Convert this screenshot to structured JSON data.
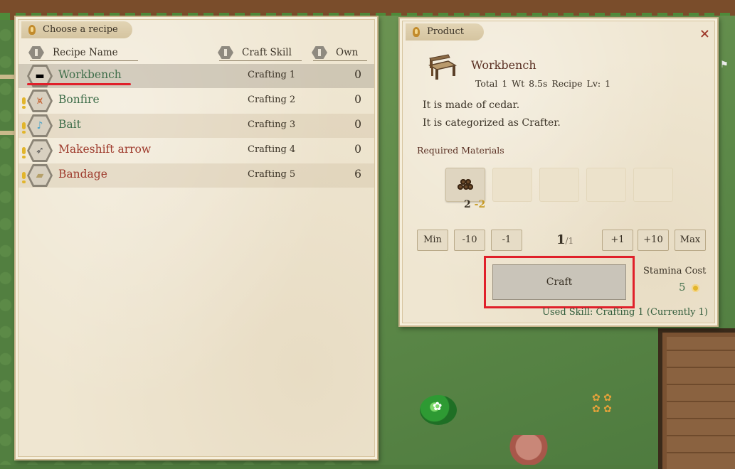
{
  "left_panel": {
    "title": "Choose a recipe",
    "columns": {
      "name": "Recipe Name",
      "skill": "Craft Skill",
      "own": "Own"
    },
    "recipes": [
      {
        "name": "Workbench",
        "skill": "Crafting 1",
        "own": "0",
        "icon": "workbench-icon",
        "warn": false,
        "color": "#3f6e4a",
        "selected": true
      },
      {
        "name": "Bonfire",
        "skill": "Crafting 2",
        "own": "0",
        "icon": "bonfire-icon",
        "warn": true,
        "color": "#3f6e4a",
        "selected": false
      },
      {
        "name": "Bait",
        "skill": "Crafting 3",
        "own": "0",
        "icon": "bait-icon",
        "warn": true,
        "color": "#3f6e4a",
        "selected": false
      },
      {
        "name": "Makeshift arrow",
        "skill": "Crafting 4",
        "own": "0",
        "icon": "arrow-icon",
        "warn": true,
        "color": "#9e3a2c",
        "selected": false
      },
      {
        "name": "Bandage",
        "skill": "Crafting 5",
        "own": "6",
        "icon": "bandage-icon",
        "warn": true,
        "color": "#9e3a2c",
        "selected": false
      }
    ]
  },
  "right_panel": {
    "title": "Product",
    "close": "×",
    "product": {
      "name": "Workbench",
      "stats": "Total 1  Wt 8.5s  Recipe Lv: 1",
      "desc1": "It is made of cedar.",
      "desc2": "It is categorized as Crafter."
    },
    "required_label": "Required Materials",
    "material": {
      "icon": "log-pile-icon",
      "have": "2",
      "need": "2"
    },
    "qty_buttons": [
      "Min",
      "-10",
      "-1",
      "+1",
      "+10",
      "Max"
    ],
    "quantity": {
      "current": "1",
      "max": "/1"
    },
    "craft_label": "Craft",
    "stamina_label": "Stamina Cost",
    "stamina_value": "5",
    "used_skill": "Used Skill: Crafting 1 (Currently 1)"
  }
}
